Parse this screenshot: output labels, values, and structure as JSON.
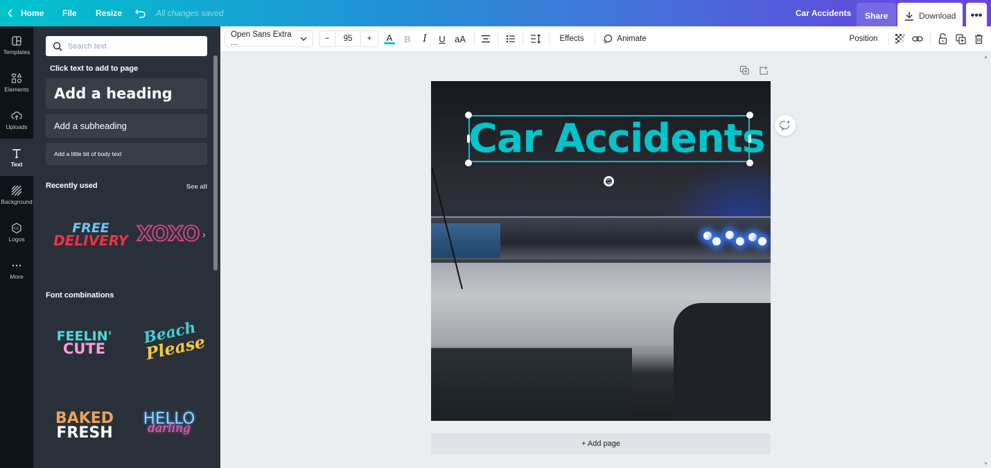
{
  "topbar": {
    "home_label": "Home",
    "file_label": "File",
    "resize_label": "Resize",
    "save_status": "All changes saved",
    "design_title": "Car Accidents",
    "share_label": "Share",
    "download_label": "Download",
    "more_label": "•••",
    "gradient": [
      "#00c3cd",
      "#2290d6",
      "#5a52dc",
      "#6c45de"
    ]
  },
  "rail": {
    "items": [
      {
        "label": "Templates",
        "icon": "templates-icon"
      },
      {
        "label": "Elements",
        "icon": "elements-icon"
      },
      {
        "label": "Uploads",
        "icon": "uploads-icon"
      },
      {
        "label": "Text",
        "icon": "text-icon",
        "active": true
      },
      {
        "label": "Background",
        "icon": "background-icon"
      },
      {
        "label": "Logos",
        "icon": "logos-icon"
      },
      {
        "label": "More",
        "icon": "more-icon"
      }
    ]
  },
  "panel": {
    "search_placeholder": "Search text",
    "click_text_title": "Click text to add to page",
    "add_heading": "Add a heading",
    "add_subheading": "Add a subheading",
    "add_body": "Add a little bit of body text",
    "recently_used_title": "Recently used",
    "see_all": "See all",
    "recent_items": [
      {
        "line1": "FREE",
        "line2": "DELIVERY"
      },
      {
        "line1": "XOXO"
      }
    ],
    "font_combinations_title": "Font combinations",
    "combos": [
      {
        "line1": "FEELIN'",
        "line2": "CUTE"
      },
      {
        "line1": "Beach",
        "line2": "Please"
      },
      {
        "line1": "BAKED",
        "line2": "FRESH"
      },
      {
        "line1": "HELLO",
        "line2": "darling"
      }
    ]
  },
  "toolbar": {
    "font_family": "Open Sans Extra ...",
    "font_size": "95",
    "decrease": "−",
    "increase": "+",
    "text_color": "#00c4cc",
    "bold": "B",
    "italic": "I",
    "underline": "U",
    "case": "aA",
    "effects_label": "Effects",
    "animate_label": "Animate",
    "position_label": "Position"
  },
  "canvas": {
    "heading_text": "Car Accidents",
    "heading_color": "#00c4cc",
    "add_page_label": "+ Add page",
    "image_alt": "Police car roof with blue flashing lights"
  }
}
